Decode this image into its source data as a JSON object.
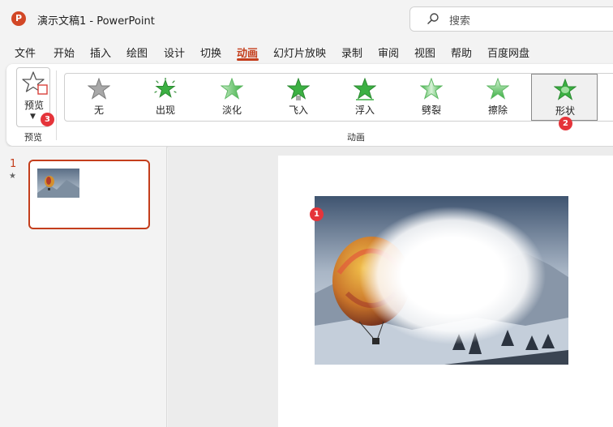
{
  "window": {
    "app_logo": "P",
    "title": "演示文稿1  -  PowerPoint",
    "search_placeholder": "搜索"
  },
  "menu": {
    "tabs": [
      {
        "label": "文件",
        "active": false
      },
      {
        "label": "开始",
        "active": false
      },
      {
        "label": "插入",
        "active": false
      },
      {
        "label": "绘图",
        "active": false
      },
      {
        "label": "设计",
        "active": false
      },
      {
        "label": "切换",
        "active": false
      },
      {
        "label": "动画",
        "active": true
      },
      {
        "label": "幻灯片放映",
        "active": false
      },
      {
        "label": "录制",
        "active": false
      },
      {
        "label": "审阅",
        "active": false
      },
      {
        "label": "视图",
        "active": false
      },
      {
        "label": "帮助",
        "active": false
      },
      {
        "label": "百度网盘",
        "active": false
      }
    ]
  },
  "ribbon": {
    "preview_button_label": "预览",
    "preview_group_label": "预览",
    "animation_group_label": "动画",
    "animations": [
      {
        "label": "无",
        "icon": "star-none-icon",
        "selected": false
      },
      {
        "label": "出现",
        "icon": "star-appear-icon",
        "selected": false
      },
      {
        "label": "淡化",
        "icon": "star-fade-icon",
        "selected": false
      },
      {
        "label": "飞入",
        "icon": "star-fly-in-icon",
        "selected": false
      },
      {
        "label": "浮入",
        "icon": "star-float-in-icon",
        "selected": false
      },
      {
        "label": "劈裂",
        "icon": "star-split-icon",
        "selected": false
      },
      {
        "label": "擦除",
        "icon": "star-wipe-icon",
        "selected": false
      },
      {
        "label": "形状",
        "icon": "star-shape-icon",
        "selected": true
      }
    ]
  },
  "badges": {
    "slide_image": "1",
    "shape_animation": "2",
    "preview": "3"
  },
  "slides_panel": {
    "slide_number": "1",
    "animation_marker": "★"
  },
  "colors": {
    "accent": "#c43e1c",
    "badge": "#e5343a",
    "star_green": "#3cb043",
    "star_gray": "#9a9a9a"
  }
}
